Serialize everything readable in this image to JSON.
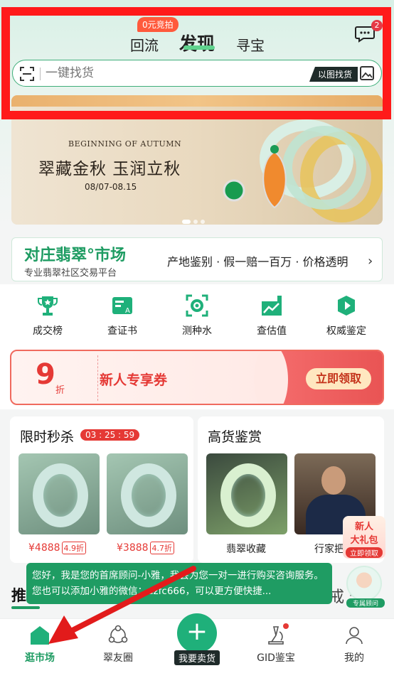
{
  "header": {
    "tabs": [
      "回流",
      "发现",
      "寻宝"
    ],
    "active_tab": "发现",
    "auction_badge": "0元竞拍",
    "message_count": "2",
    "search_placeholder": "一键找货",
    "image_search_label": "以图找货"
  },
  "banner": {
    "small_title": "BEGINNING OF AUTUMN",
    "main_title": "翠藏金秋 玉润立秋",
    "date": "08/07-08.15"
  },
  "market": {
    "title": "对庄翡翠°市场",
    "subtitle": "专业翡翠社区交易平台",
    "tags": "产地鉴别 · 假一赔一百万 · 价格透明"
  },
  "grid": [
    {
      "label": "成交榜",
      "icon": "trophy-icon"
    },
    {
      "label": "查证书",
      "icon": "certificate-icon"
    },
    {
      "label": "测种水",
      "icon": "scan-gem-icon"
    },
    {
      "label": "查估值",
      "icon": "chart-icon"
    },
    {
      "label": "权威鉴定",
      "icon": "auth-icon"
    }
  ],
  "coupon": {
    "number": "9",
    "unit": "折",
    "text": "新人专享券",
    "button": "立即领取"
  },
  "flash_sale": {
    "title": "限时秒杀",
    "timer": "03 : 25 : 59",
    "items": [
      {
        "price": "¥4888",
        "discount": "4.9折"
      },
      {
        "price": "¥3888",
        "discount": "4.7折"
      }
    ]
  },
  "appraisal": {
    "title": "高货鉴赏",
    "items": [
      {
        "label": "翡翠收藏"
      },
      {
        "label": "行家把"
      }
    ]
  },
  "promo": {
    "line1": "新人",
    "line2": "大礼包",
    "button": "立即领取"
  },
  "section": {
    "left_peek": "推",
    "right_peek": "戒 天"
  },
  "tip": {
    "text": "您好，我是您的首席顾问-小雅，我会为您一对一进行购买咨询服务。您也可以添加小雅的微信：dzfc666，可以更方便快捷..."
  },
  "advisor": {
    "tag": "专属顾问"
  },
  "nav": {
    "items": [
      "逛市场",
      "翠友圈",
      "我要卖货",
      "GID鉴宝",
      "我的"
    ],
    "active": "逛市场"
  },
  "colors": {
    "brand_green": "#1f9c63",
    "coupon_red": "#e53935",
    "highlight_frame": "#ff1a1a"
  }
}
